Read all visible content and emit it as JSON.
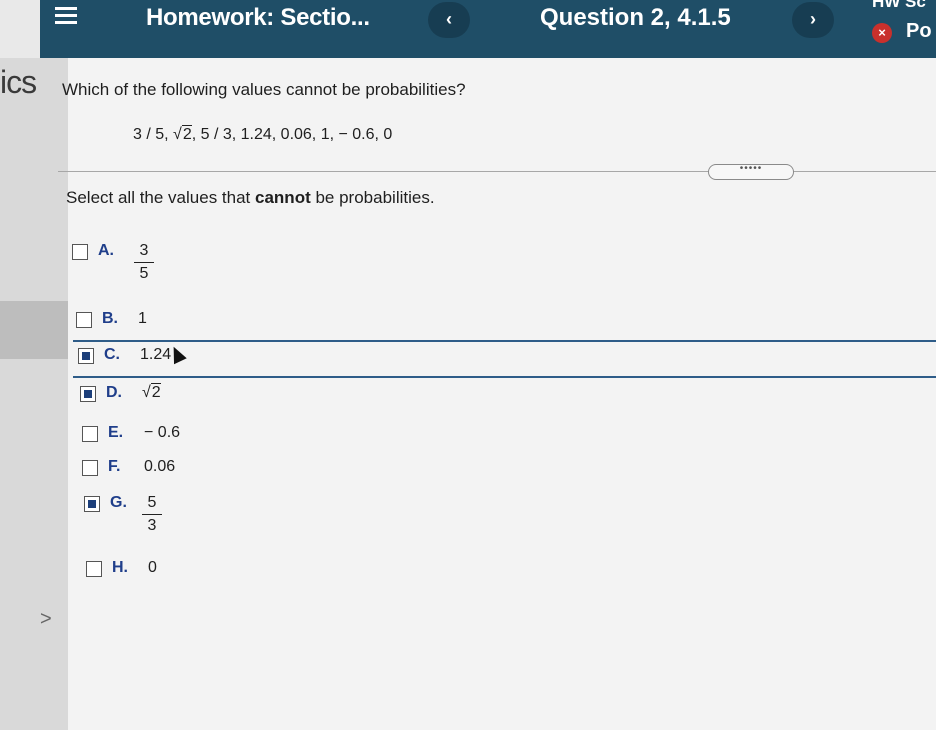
{
  "header": {
    "title": "Homework: Sectio...",
    "question": "Question 2, 4.1.5",
    "prev_label": "‹",
    "next_label": "›",
    "hw_score": "HW Sc",
    "points": "Po",
    "close_icon_glyph": "×"
  },
  "sidebar": {
    "partial_text": "ics",
    "chevron": ">"
  },
  "question": {
    "prompt": "Which of the following values cannot be probabilities?",
    "values_prefix": "3 / 5, ",
    "values_sqrt": "2",
    "values_suffix": ", 5 / 3, 1.24, 0.06, 1, − 0.6, 0",
    "instruction_pre": "Select all the values that ",
    "instruction_bold": "cannot",
    "instruction_post": " be probabilities."
  },
  "handle": {
    "dots": "•••••"
  },
  "options": [
    {
      "letter": "A.",
      "num": "3",
      "den": "5",
      "checked": false
    },
    {
      "letter": "B.",
      "value": "1",
      "checked": false
    },
    {
      "letter": "C.",
      "value": "1.24",
      "checked": true
    },
    {
      "letter": "D.",
      "sqrt": "2",
      "checked": true
    },
    {
      "letter": "E.",
      "value": "− 0.6",
      "checked": false
    },
    {
      "letter": "F.",
      "value": "0.06",
      "checked": false
    },
    {
      "letter": "G.",
      "num": "5",
      "den": "3",
      "checked": true
    },
    {
      "letter": "H.",
      "value": "0",
      "checked": false
    }
  ],
  "colors": {
    "header_bg": "#1f4e67",
    "accent": "#1d3f7a",
    "error": "#c9302c"
  }
}
